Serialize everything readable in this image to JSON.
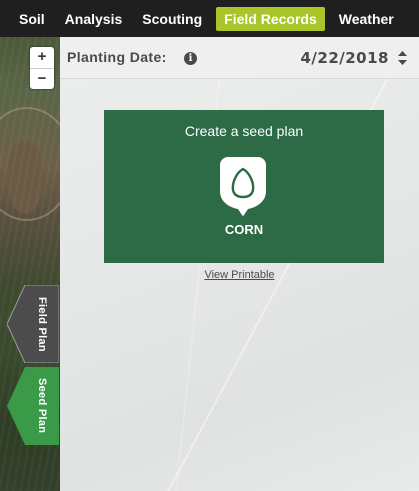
{
  "nav": {
    "tabs": [
      {
        "label": "Soil"
      },
      {
        "label": "Analysis"
      },
      {
        "label": "Scouting"
      },
      {
        "label": "Field Records",
        "active": true
      },
      {
        "label": "Weather"
      }
    ],
    "active_color": "#a8c62a"
  },
  "map": {
    "zoom_in": "+",
    "zoom_out": "−"
  },
  "side_tabs": {
    "field_plan": "Field Plan",
    "seed_plan": "Seed Plan"
  },
  "header": {
    "label": "Planting Date:",
    "info_icon": "i",
    "date": "4/22/2018"
  },
  "seed_card": {
    "title": "Create a seed plan",
    "crop": "CORN",
    "icon": "corn-seed-icon",
    "color": "#2c6b46"
  },
  "view_printable": "View Printable"
}
